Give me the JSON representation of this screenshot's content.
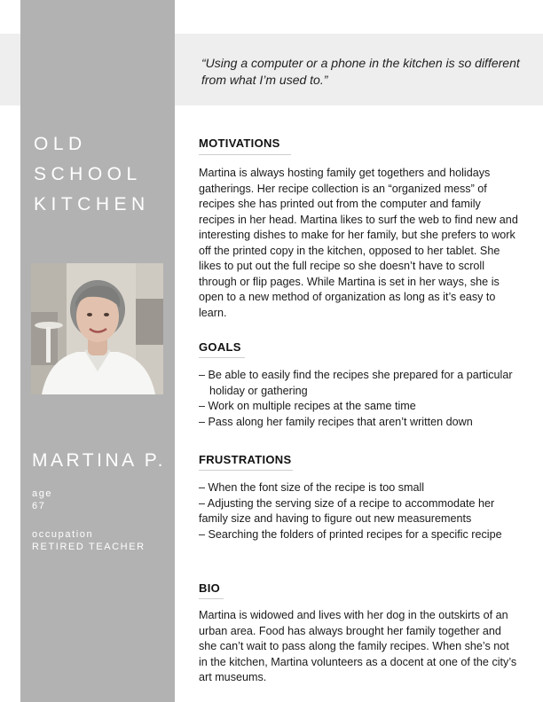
{
  "quote": "“Using a computer or a phone in the kitchen is so different from what I’m used to.”",
  "title_lines": [
    "OLD",
    "SCHOOL",
    "KITCHEN"
  ],
  "persona": {
    "name": "MARTINA P.",
    "age_label": "age",
    "age_value": "67",
    "occupation_label": "occupation",
    "occupation_value": "RETIRED TEACHER"
  },
  "sections": {
    "motivations": {
      "heading": "MOTIVATIONS",
      "text": "Martina is always hosting family get togethers and holidays gatherings. Her recipe collection is an “organized mess” of recipes she has printed out from the computer and family recipes in her head. Martina likes to surf the web to find new and interesting dishes to make for her family, but she prefers to work off the printed copy in the kitchen, opposed to her tablet. She likes to put out the full recipe so she doesn’t have to scroll through or flip pages. While Martina is set in her ways, she is open to a new method of organization as long as it’s easy to learn."
    },
    "goals": {
      "heading": "GOALS",
      "items": [
        "– Be able to easily find the recipes she prepared for a particular holiday or gathering",
        "– Work on multiple recipes at the same time",
        "– Pass along her family recipes that aren’t written down"
      ]
    },
    "frustrations": {
      "heading": "FRUSTRATIONS",
      "items": [
        "– When the font size of the recipe is too small",
        "– Adjusting the serving size of a recipe to accommodate her family size and having to figure out new measurements",
        "– Searching the folders of printed recipes for a specific recipe"
      ]
    },
    "bio": {
      "heading": "BIO",
      "text": "Martina is widowed and lives with her dog in the outskirts of an urban area. Food has always brought her family together and she can’t wait to pass along the family recipes. When she’s not in the kitchen, Martina volunteers as a docent at one of the city’s art museums."
    }
  },
  "colors": {
    "sidebar": "#b2b2b2",
    "quote_band": "#eeeeee",
    "text": "#1a1a1a"
  }
}
